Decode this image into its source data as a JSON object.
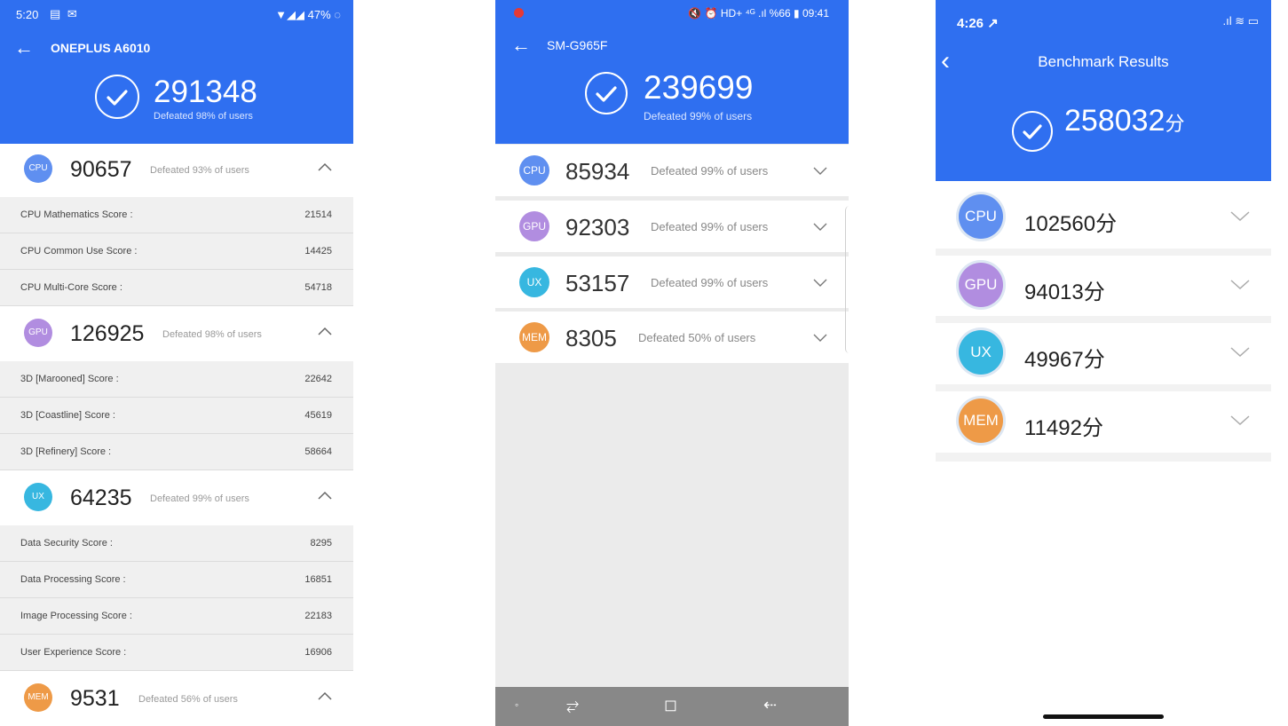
{
  "colors": {
    "header_blue": "#2f6ff0",
    "cpu": "#5f8ff0",
    "gpu": "#b18de0",
    "ux": "#37b7e0",
    "mem": "#ee9a47"
  },
  "panel1": {
    "status": {
      "time": "5:20",
      "left_icons": "▤ ✉",
      "right": "▼◢◢ 47% ◌"
    },
    "device": "ONEPLUS A6010",
    "total": "291348",
    "defeated": "Defeated 98% of users",
    "sections": [
      {
        "badge": "CPU",
        "score": "90657",
        "defeated": "Defeated 93% of users",
        "items": [
          {
            "label": "CPU Mathematics Score :",
            "value": "21514"
          },
          {
            "label": "CPU Common Use Score :",
            "value": "14425"
          },
          {
            "label": "CPU Multi-Core Score :",
            "value": "54718"
          }
        ]
      },
      {
        "badge": "GPU",
        "score": "126925",
        "defeated": "Defeated 98% of users",
        "items": [
          {
            "label": "3D [Marooned] Score :",
            "value": "22642"
          },
          {
            "label": "3D [Coastline] Score :",
            "value": "45619"
          },
          {
            "label": "3D [Refinery] Score :",
            "value": "58664"
          }
        ]
      },
      {
        "badge": "UX",
        "score": "64235",
        "defeated": "Defeated 99% of users",
        "items": [
          {
            "label": "Data Security Score :",
            "value": "8295"
          },
          {
            "label": "Data Processing Score :",
            "value": "16851"
          },
          {
            "label": "Image Processing Score :",
            "value": "22183"
          },
          {
            "label": "User Experience Score :",
            "value": "16906"
          }
        ]
      },
      {
        "badge": "MEM",
        "score": "9531",
        "defeated": "Defeated 56% of users",
        "items": []
      }
    ]
  },
  "panel2": {
    "status": {
      "right": "🔇 ⏰ HD+ ⁴ᴳ .ıl %66 ▮ 09:41"
    },
    "device": "SM-G965F",
    "total": "239699",
    "defeated": "Defeated 99% of users",
    "rows": [
      {
        "badge": "CPU",
        "score": "85934",
        "defeated": "Defeated 99% of users"
      },
      {
        "badge": "GPU",
        "score": "92303",
        "defeated": "Defeated 99% of users"
      },
      {
        "badge": "UX",
        "score": "53157",
        "defeated": "Defeated 99% of users"
      },
      {
        "badge": "MEM",
        "score": "8305",
        "defeated": "Defeated 50% of users"
      }
    ],
    "nav": {
      "home_dot": "◦",
      "recents": "⥂",
      "home": "◻",
      "back": "⇠"
    }
  },
  "panel3": {
    "status": {
      "time": "4:26 ↗",
      "right": ".ıl ≋ ▭"
    },
    "title": "Benchmark Results",
    "total": "258032",
    "unit": "分",
    "rows": [
      {
        "badge": "CPU",
        "score": "102560分"
      },
      {
        "badge": "GPU",
        "score": "94013分"
      },
      {
        "badge": "UX",
        "score": "49967分"
      },
      {
        "badge": "MEM",
        "score": "11492分"
      }
    ]
  }
}
